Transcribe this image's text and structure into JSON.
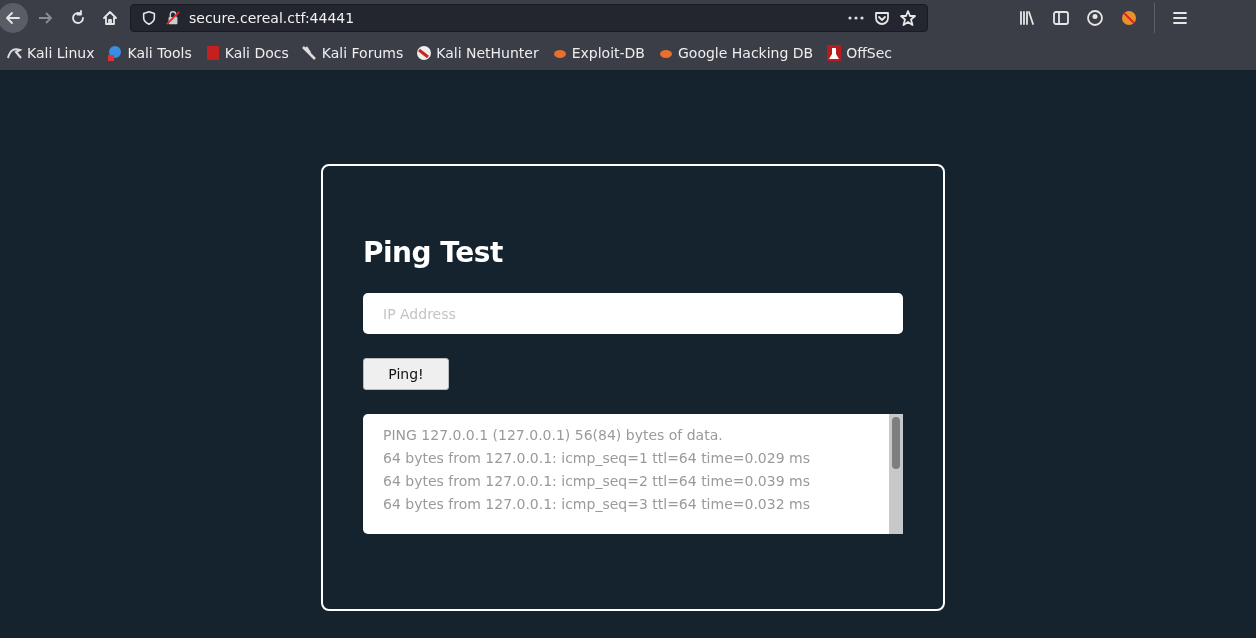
{
  "browser": {
    "url": "secure.cereal.ctf:44441",
    "bookmarks": [
      {
        "label": "Kali Linux"
      },
      {
        "label": "Kali Tools"
      },
      {
        "label": "Kali Docs"
      },
      {
        "label": "Kali Forums"
      },
      {
        "label": "Kali NetHunter"
      },
      {
        "label": "Exploit-DB"
      },
      {
        "label": "Google Hacking DB"
      },
      {
        "label": "OffSec"
      }
    ]
  },
  "page": {
    "title": "Ping Test",
    "ip_field": {
      "placeholder": "IP Address"
    },
    "button": "Ping!",
    "output": [
      "PING 127.0.0.1 (127.0.0.1) 56(84) bytes of data.",
      "64 bytes from 127.0.0.1: icmp_seq=1 ttl=64 time=0.029 ms",
      "64 bytes from 127.0.0.1: icmp_seq=2 ttl=64 time=0.039 ms",
      "64 bytes from 127.0.0.1: icmp_seq=3 ttl=64 time=0.032 ms"
    ]
  }
}
